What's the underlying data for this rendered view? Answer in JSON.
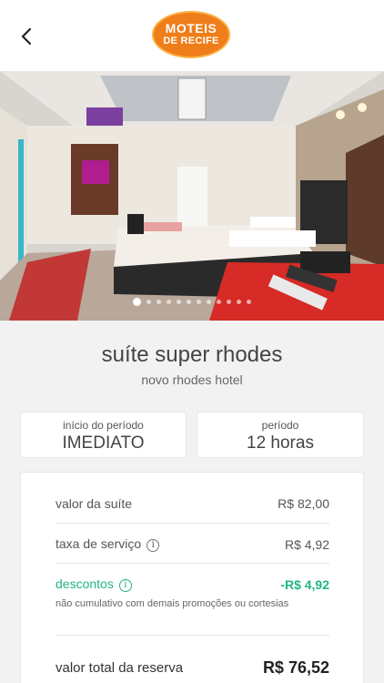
{
  "header": {
    "logo": {
      "line1": "MOTEIS",
      "line2": "DE RECIFE",
      "color": "#ef7d1a"
    }
  },
  "carousel": {
    "slide_count": 12,
    "active_index": 0
  },
  "suite": {
    "name": "suíte super rhodes",
    "hotel": "novo rhodes hotel"
  },
  "booking": {
    "start": {
      "label": "início do período",
      "value": "IMEDIATO"
    },
    "period": {
      "label": "período",
      "value": "12 horas"
    }
  },
  "pricing": {
    "suite_value": {
      "label": "valor da suíte",
      "value": "R$ 82,00"
    },
    "service_fee": {
      "label": "taxa de serviço",
      "value": "R$ 4,92"
    },
    "discounts": {
      "label": "descontos",
      "value": "-R$ 4,92",
      "note": "não cumulativo com demais promoções ou cortesias",
      "color": "#21b585"
    },
    "total": {
      "label": "valor total da reserva",
      "value": "R$ 76,52"
    }
  }
}
